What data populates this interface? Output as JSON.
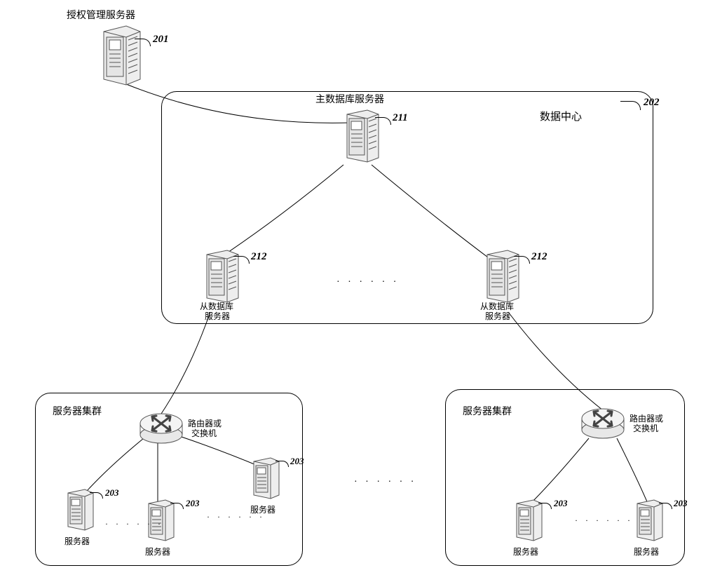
{
  "labels": {
    "auth_server_title": "授权管理服务器",
    "data_center": "数据中心",
    "master_db": "主数据库服务器",
    "slave_db_l1": "从数据库",
    "slave_db_l2": "服务器",
    "cluster": "服务器集群",
    "router_l1": "路由器或",
    "router_l2": "交换机",
    "server": "服务器"
  },
  "refs": {
    "r201": "201",
    "r202": "202",
    "r211": "211",
    "r212": "212",
    "r203": "203"
  },
  "dots": "· · · · · ·"
}
